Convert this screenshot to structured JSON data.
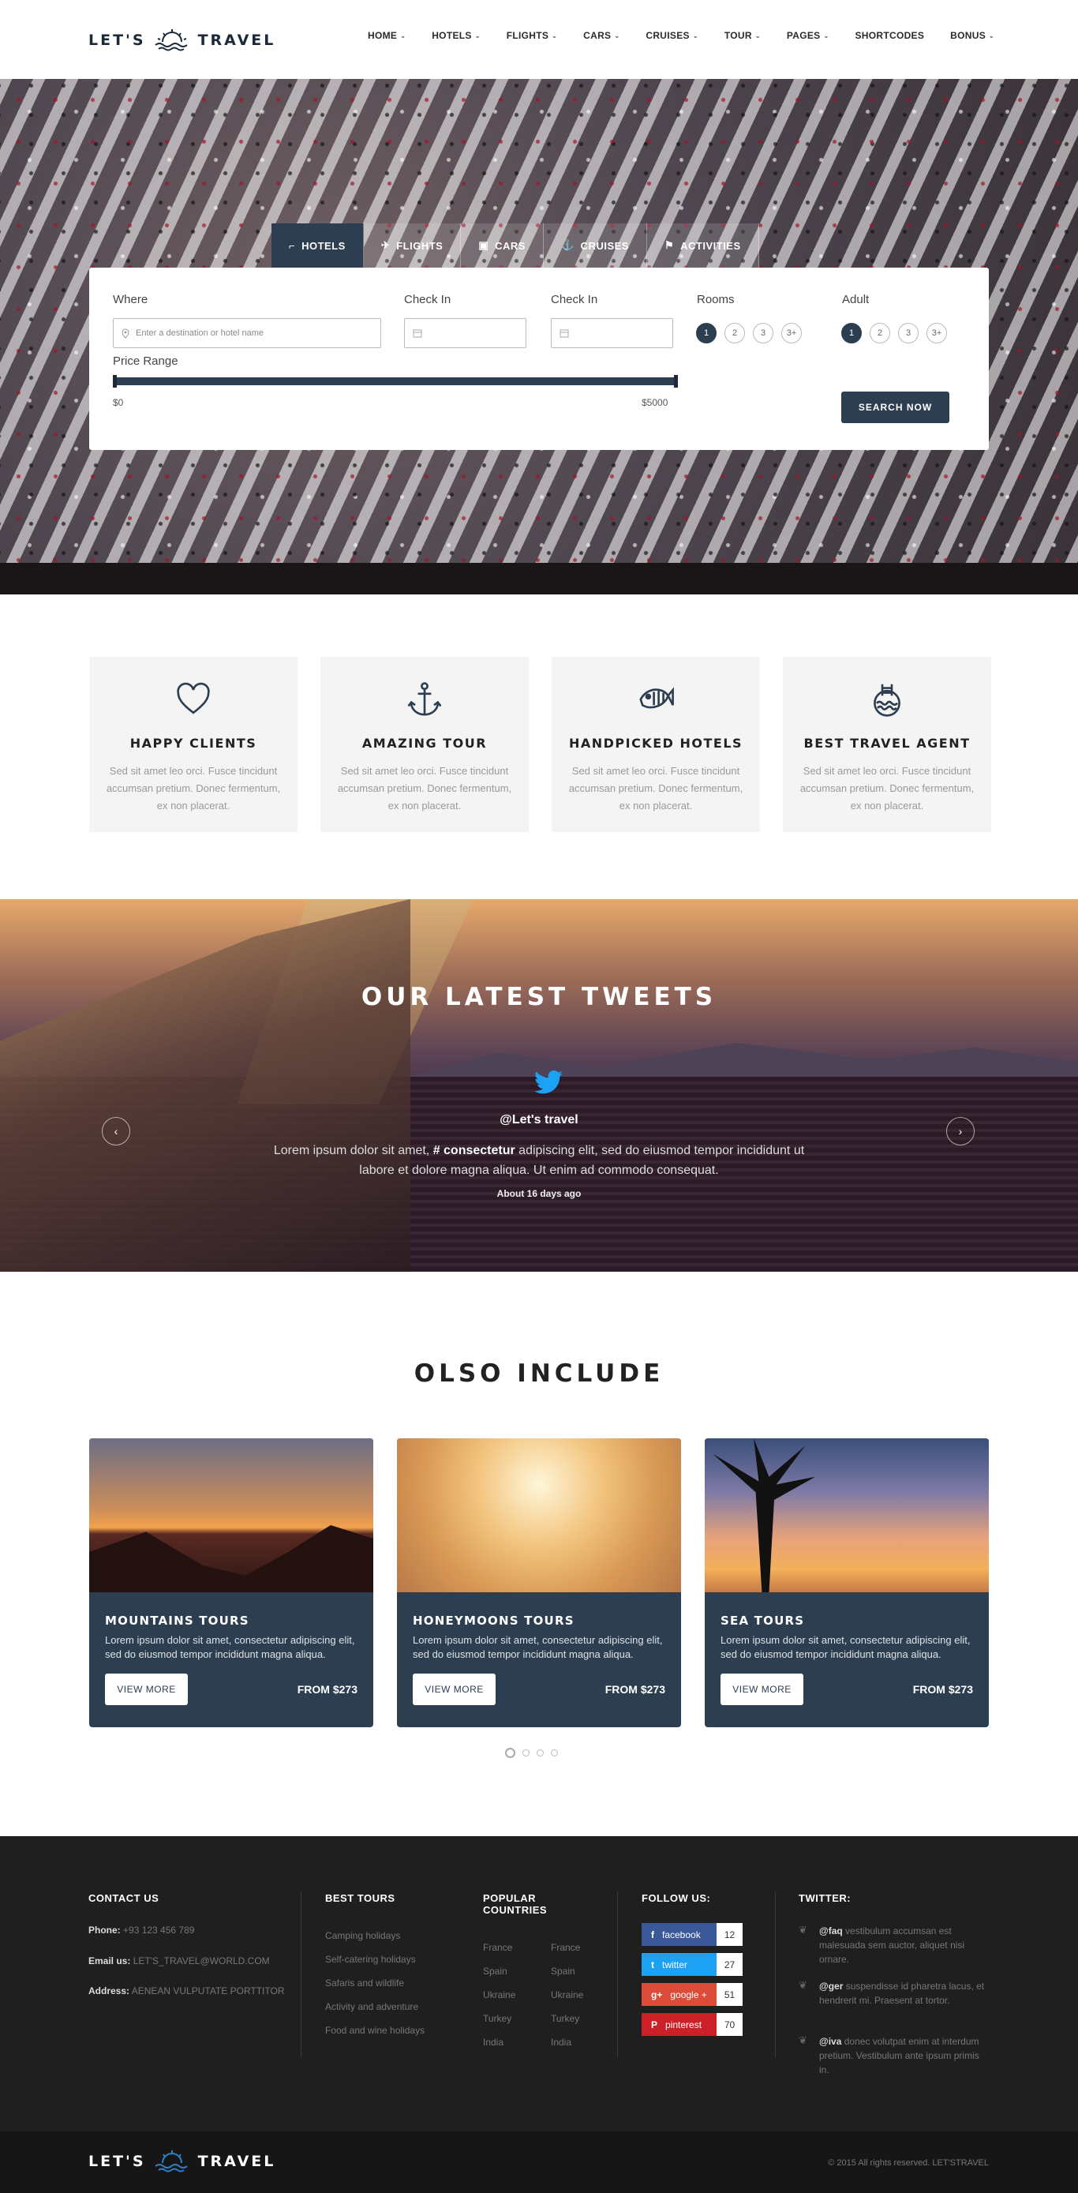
{
  "brand": {
    "left": "LET'S",
    "right": "TRAVEL"
  },
  "nav": [
    "HOME",
    "HOTELS",
    "FLIGHTS",
    "CARS",
    "CRUISES",
    "TOUR",
    "PAGES",
    "SHORTCODES",
    "BONUS"
  ],
  "nav_dropdown": [
    true,
    true,
    true,
    true,
    true,
    true,
    true,
    false,
    true
  ],
  "search": {
    "tabs": [
      "HOTELS",
      "FLIGHTS",
      "CARS",
      "CRUISES",
      "ACTIVITIES"
    ],
    "where_label": "Where",
    "where_placeholder": "Enter a destination or hotel name",
    "checkin_label": "Check In",
    "checkin2_label": "Check In",
    "rooms_label": "Rooms",
    "adult_label": "Adult",
    "options": [
      "1",
      "2",
      "3",
      "3+"
    ],
    "price_label": "Price Range",
    "price_min": "$0",
    "price_max": "$5000",
    "button": "SEARCH NOW"
  },
  "features": [
    {
      "icon": "heart-icon",
      "title": "HAPPY CLIENTS",
      "text": "Sed sit amet leo orci. Fusce tincidunt accumsan pretium. Donec fermentum, ex non placerat."
    },
    {
      "icon": "anchor-icon",
      "title": "AMAZING TOUR",
      "text": "Sed sit amet leo orci. Fusce tincidunt accumsan pretium. Donec fermentum, ex non placerat."
    },
    {
      "icon": "fish-icon",
      "title": "HANDPICKED HOTELS",
      "text": "Sed sit amet leo orci. Fusce tincidunt accumsan pretium. Donec fermentum, ex non placerat."
    },
    {
      "icon": "pool-icon",
      "title": "BEST TRAVEL AGENT",
      "text": "Sed sit amet leo orci. Fusce tincidunt accumsan pretium. Donec fermentum, ex non placerat."
    }
  ],
  "tweets": {
    "title": "OUR LATEST TWEETS",
    "handle": "@Let's travel",
    "text_before": "Lorem ipsum dolor sit amet, ",
    "hashtag": "# consectetur",
    "text_after": " adipiscing elit, sed do eiusmod tempor incididunt ut labore et dolore magna aliqua. Ut enim ad commodo consequat.",
    "time": "About 16 days ago"
  },
  "include": {
    "title": "OLSO INCLUDE",
    "cards": [
      {
        "title": "MOUNTAINS TOURS",
        "text": "Lorem ipsum dolor sit amet, consectetur adipiscing elit, sed do eiusmod tempor incididunt magna aliqua.",
        "button": "VIEW MORE",
        "price": "FROM $273"
      },
      {
        "title": "HONEYMOONS TOURS",
        "text": "Lorem ipsum dolor sit amet, consectetur adipiscing elit, sed do eiusmod tempor incididunt magna aliqua.",
        "button": "VIEW MORE",
        "price": "FROM $273"
      },
      {
        "title": "SEA TOURS",
        "text": "Lorem ipsum dolor sit amet, consectetur adipiscing elit, sed do eiusmod tempor incididunt magna aliqua.",
        "button": "VIEW MORE",
        "price": "FROM $273"
      }
    ]
  },
  "footer": {
    "contact_title": "CONTACT US",
    "phone_label": "Phone:",
    "phone": "+93 123 456 789",
    "email_label": "Email us:",
    "email": "LET'S_TRAVEL@WORLD.COM",
    "address_label": "Address:",
    "address": "AENEAN VULPUTATE PORTTITOR",
    "tours_title": "BEST TOURS",
    "tours": [
      "Camping holidays",
      "Self-catering holidays",
      "Safaris and wildlife",
      "Activity and adventure",
      "Food and wine holidays"
    ],
    "countries_title": "POPULAR COUNTRIES",
    "countries_a": [
      "France",
      "Spain",
      "Ukraine",
      "Turkey",
      "India"
    ],
    "countries_b": [
      "France",
      "Spain",
      "Ukraine",
      "Turkey",
      "India"
    ],
    "follow_title": "FOLLOW US:",
    "social": [
      {
        "name": "facebook",
        "count": "12",
        "color": "#3b5998"
      },
      {
        "name": "twitter",
        "count": "27",
        "color": "#1da1f2"
      },
      {
        "name": "google +",
        "count": "51",
        "color": "#dd4b39"
      },
      {
        "name": "pinterest",
        "count": "70",
        "color": "#cb2027"
      }
    ],
    "twitter_title": "TWITTER:",
    "twitter": [
      {
        "user": "@faq",
        "text": " vestibulum accumsan est malesuada sem auctor, aliquet nisi ornare."
      },
      {
        "user": "@ger",
        "text": " suspendisse id pharetra lacus, et hendrerit mi. Praesent at tortor."
      },
      {
        "user": "@iva",
        "text": " donec volutpat enim at interdum pretium. Vestibulum ante ipsum primis in."
      }
    ],
    "copyright": "© 2015 All rights reserved. LET'STRAVEL"
  },
  "colors": {
    "primary": "#2c3e50",
    "footer": "#1f1f1f",
    "twitter": "#1da1f2"
  }
}
